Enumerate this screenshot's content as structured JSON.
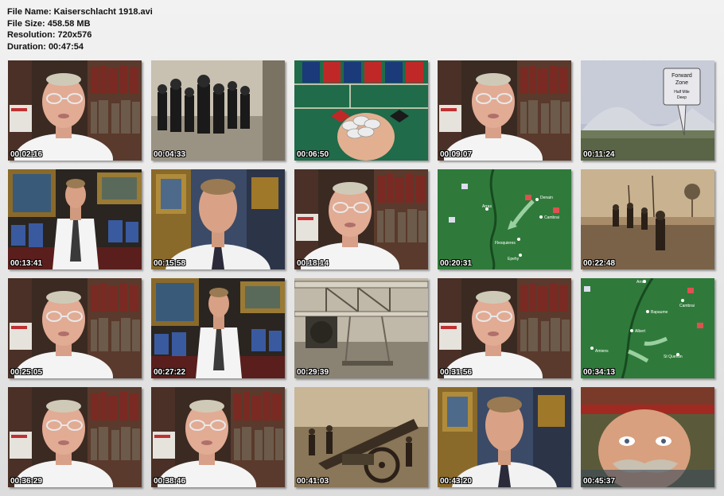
{
  "file_info": {
    "name_line": "File Name: Kaiserschlacht 1918.avi",
    "size_line": "File Size: 458.58 MB",
    "resolution_line": "Resolution: 720x576",
    "duration_line": "Duration: 00:47:54"
  },
  "thumbnails": [
    {
      "time": "00:02:16",
      "scene": "interview-man-glasses"
    },
    {
      "time": "00:04:33",
      "scene": "archival-soldiers-marching"
    },
    {
      "time": "00:06:50",
      "scene": "roulette-table-chips"
    },
    {
      "time": "00:09:07",
      "scene": "interview-man-glasses"
    },
    {
      "time": "00:11:24",
      "scene": "forward-zone-diagram"
    },
    {
      "time": "00:13:41",
      "scene": "interview-man-tie-standing"
    },
    {
      "time": "00:15:58",
      "scene": "interview-man-tie"
    },
    {
      "time": "00:18:14",
      "scene": "interview-man-glasses"
    },
    {
      "time": "00:20:31",
      "scene": "campaign-map"
    },
    {
      "time": "00:22:48",
      "scene": "archival-battlefield-sepia"
    },
    {
      "time": "00:25:05",
      "scene": "interview-man-glasses"
    },
    {
      "time": "00:27:22",
      "scene": "interview-man-tie-standing"
    },
    {
      "time": "00:29:39",
      "scene": "archival-biplane"
    },
    {
      "time": "00:31:56",
      "scene": "interview-man-glasses"
    },
    {
      "time": "00:34:13",
      "scene": "campaign-map"
    },
    {
      "time": "00:36:29",
      "scene": "interview-man-glasses"
    },
    {
      "time": "00:38:46",
      "scene": "interview-man-glasses"
    },
    {
      "time": "00:41:03",
      "scene": "archival-artillery"
    },
    {
      "time": "00:43:20",
      "scene": "interview-man-tie"
    },
    {
      "time": "00:45:37",
      "scene": "portrait-general-painting"
    }
  ],
  "forward_zone": {
    "title_line1": "Forward",
    "title_line2": "Zone",
    "sub_line1": "Half Mile",
    "sub_line2": "Deep"
  },
  "map1_labels": {
    "city_a": "Arras",
    "city_b": "Denain",
    "city_c": "Cambrai",
    "city_d": "Flesquieres",
    "city_e": "Epehy"
  },
  "map2_labels": {
    "city_a": "Arras",
    "city_b": "Bapaume",
    "city_c": "Cambrai",
    "city_d": "Albert",
    "city_e": "Amiens",
    "city_f": "St Quentin"
  },
  "colors": {
    "map_green": "#2f7a3a",
    "sepia": "#8a6f4f",
    "shirt": "#f4f4f4"
  }
}
